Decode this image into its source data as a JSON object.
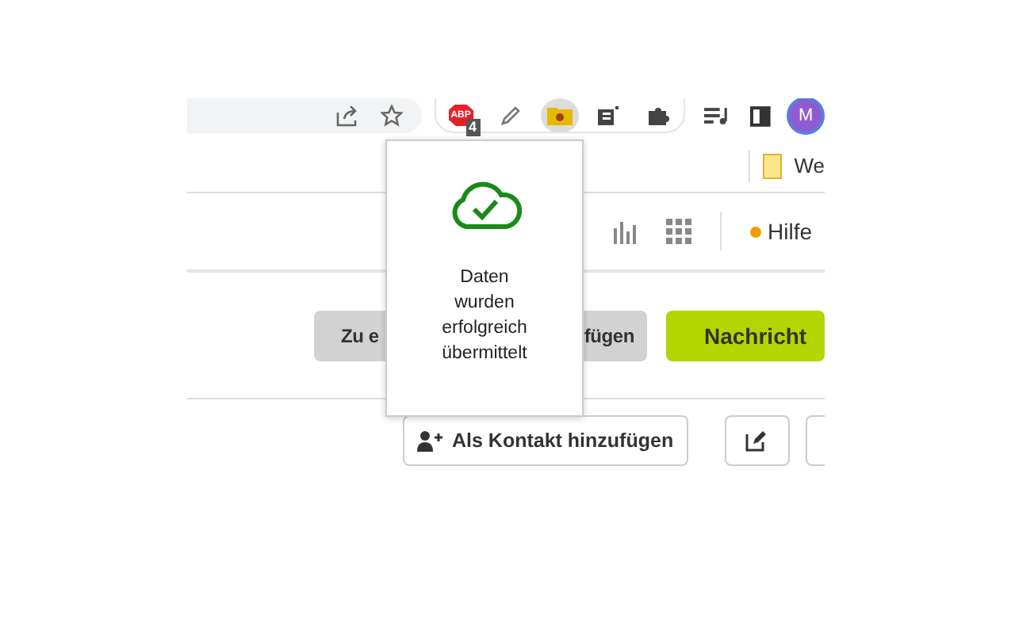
{
  "browser_toolbar": {
    "extensions": [
      {
        "kind": "adblock",
        "text": "ABP",
        "badge": "4",
        "selected": false
      },
      {
        "kind": "pencil",
        "selected": false
      },
      {
        "kind": "folder",
        "selected": true
      },
      {
        "kind": "e",
        "selected": false
      },
      {
        "kind": "puzzle",
        "selected": false
      }
    ],
    "avatar": "M"
  },
  "bookmarks": [
    {
      "label": "We"
    }
  ],
  "nav": {
    "help": "Hilfe"
  },
  "actions": {
    "secondary": {
      "label_start": "Zu e",
      "label_end": "fügen"
    },
    "primary": {
      "label": "Nachricht"
    }
  },
  "contact_actions": {
    "add_contact": "Als Kontakt hinzufügen"
  },
  "popup": {
    "lines": [
      "Daten",
      "wurden",
      "erfolgreich",
      "übermittelt"
    ]
  }
}
